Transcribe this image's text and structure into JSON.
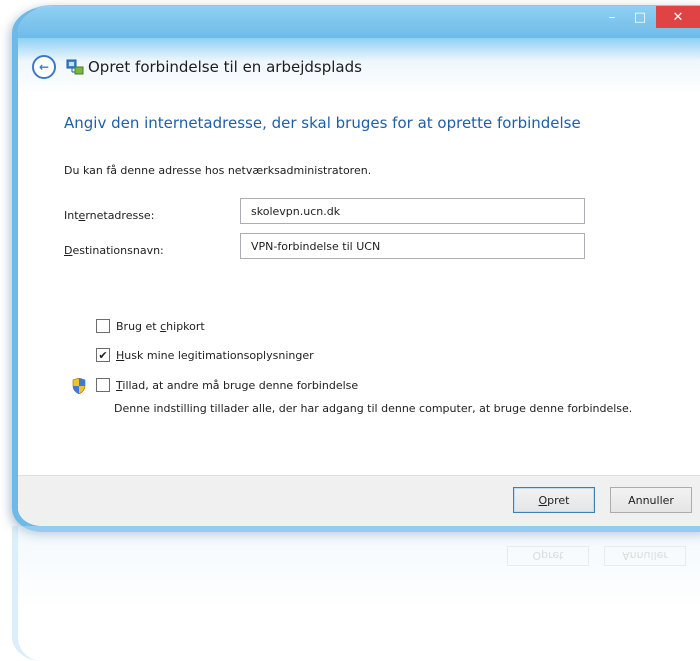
{
  "titlebar": {
    "minimize_label": "–",
    "maximize_label": "□",
    "close_label": "✕"
  },
  "header": {
    "back_icon": "back-arrow-icon",
    "wizard_icon": "network-connection-icon",
    "title": "Opret forbindelse til en arbejdsplads"
  },
  "main": {
    "instruction": "Angiv den internetadresse, der skal bruges for at oprette forbindelse",
    "hint": "Du kan få denne adresse hos netværksadministratoren.",
    "internet_address": {
      "label_pre": "Int",
      "label_accel": "e",
      "label_post": "rnetadresse:",
      "value": "skolevpn.ucn.dk"
    },
    "destination_name": {
      "label_pre": "",
      "label_accel": "D",
      "label_post": "estinationsnavn:",
      "value": "VPN-forbindelse til UCN"
    },
    "options": [
      {
        "pre": "Brug et ",
        "accel": "c",
        "post": "hipkort",
        "checked": false
      },
      {
        "pre": "",
        "accel": "H",
        "post": "usk mine legitimationsoplysninger",
        "checked": true
      },
      {
        "pre": "",
        "accel": "T",
        "post": "illad, at andre må bruge denne forbindelse",
        "checked": false
      }
    ],
    "shared_description": "Denne indstilling tillader alle, der har adgang til denne computer, at bruge denne forbindelse."
  },
  "footer": {
    "create_pre": "",
    "create_accel": "O",
    "create_post": "pret",
    "cancel_label": "Annuller"
  },
  "colors": {
    "titlebar": "#6ebbe8",
    "instruction_text": "#1e5fa8",
    "close_button": "#e04343"
  }
}
